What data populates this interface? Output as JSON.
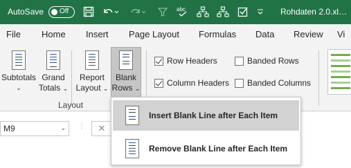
{
  "titlebar": {
    "autosave_label": "AutoSave",
    "autosave_state": "Off",
    "doc_title": "Rohdaten 2.0.xl…"
  },
  "menu": [
    "File",
    "Home",
    "Insert",
    "Page Layout",
    "Formulas",
    "Data",
    "Review",
    "Vi"
  ],
  "ribbon": {
    "subtotals": "Subtotals",
    "grand_line1": "Grand",
    "grand_line2": "Totals",
    "report_line1": "Report",
    "report_line2": "Layout",
    "blank_line1": "Blank",
    "blank_line2": "Rows",
    "group_label": "Layout",
    "row_headers": "Row Headers",
    "column_headers": "Column Headers",
    "banded_rows": "Banded Rows",
    "banded_columns": "Banded Columns",
    "row_headers_checked": true,
    "column_headers_checked": true,
    "banded_rows_checked": false,
    "banded_columns_checked": false
  },
  "formula_bar": {
    "name_box": "M9",
    "cancel_symbol": "✕"
  },
  "dropdown": {
    "items": [
      {
        "label": "Insert Blank Line after Each Item",
        "highlighted": true
      },
      {
        "label": "Remove Blank Line after Each Item",
        "highlighted": false
      }
    ]
  }
}
